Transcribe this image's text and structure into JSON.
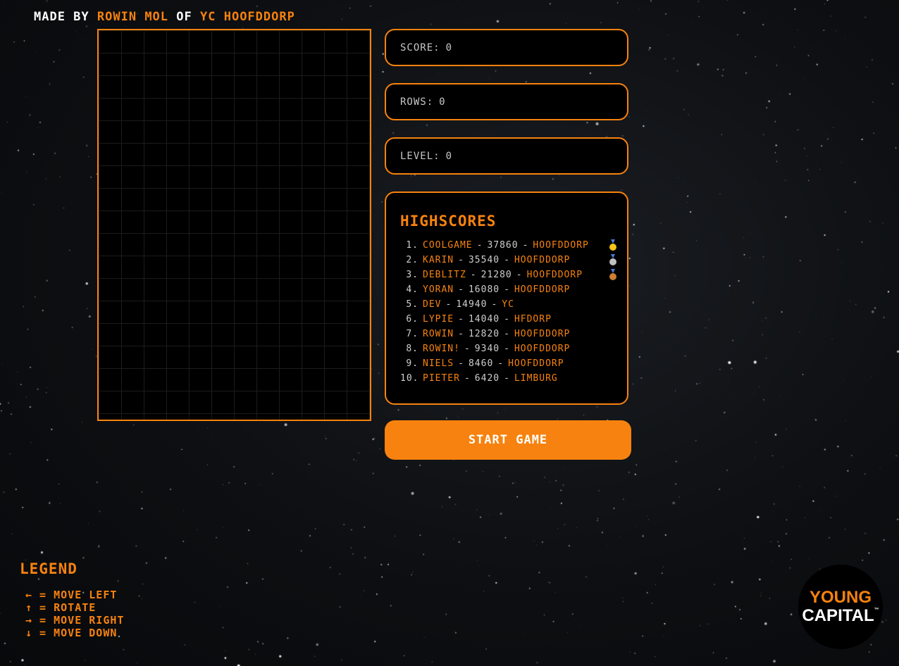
{
  "credits": {
    "made_by": "MADE BY",
    "author": "ROWIN MOL",
    "of": "OF",
    "company": "YC HOOFDDORP"
  },
  "stats": {
    "score_label": "SCORE",
    "score_value": "0",
    "rows_label": "ROWS",
    "rows_value": "0",
    "level_label": "LEVEL",
    "level_value": "0"
  },
  "highscores": {
    "title": "HIGHSCORES",
    "entries": [
      {
        "rank": "1.",
        "name": "COOLGAME",
        "score": "37860",
        "city": "HOOFDDORP",
        "medal": "gold"
      },
      {
        "rank": "2.",
        "name": "KARIN",
        "score": "35540",
        "city": "HOOFDDORP",
        "medal": "silver"
      },
      {
        "rank": "3.",
        "name": "DEBLITZ",
        "score": "21280",
        "city": "HOOFDDORP",
        "medal": "bronze"
      },
      {
        "rank": "4.",
        "name": "YORAN",
        "score": "16080",
        "city": "HOOFDDORP",
        "medal": ""
      },
      {
        "rank": "5.",
        "name": "DEV",
        "score": "14940",
        "city": "YC",
        "medal": ""
      },
      {
        "rank": "6.",
        "name": "LYPIE",
        "score": "14040",
        "city": "HFDORP",
        "medal": ""
      },
      {
        "rank": "7.",
        "name": "ROWIN",
        "score": "12820",
        "city": "HOOFDDORP",
        "medal": ""
      },
      {
        "rank": "8.",
        "name": "ROWIN!",
        "score": "9340",
        "city": "HOOFDDORP",
        "medal": ""
      },
      {
        "rank": "9.",
        "name": "NIELS",
        "score": "8460",
        "city": "HOOFDDORP",
        "medal": ""
      },
      {
        "rank": "10.",
        "name": "PIETER",
        "score": "6420",
        "city": "LIMBURG",
        "medal": ""
      }
    ]
  },
  "start_button": "START GAME",
  "legend": {
    "title": "LEGEND",
    "items": [
      "← = MOVE LEFT",
      "↑ = ROTATE",
      "→ = MOVE RIGHT",
      "↓ = MOVE DOWN"
    ]
  },
  "logo": {
    "line1": "YOUNG",
    "line2": "CAPITAL",
    "tm": "™"
  },
  "colors": {
    "accent": "#f7820f",
    "background": "#0d0f12",
    "text": "#cfcfcf",
    "gold": "#f5c518",
    "silver": "#c0c0c0",
    "bronze": "#cd7f32"
  }
}
